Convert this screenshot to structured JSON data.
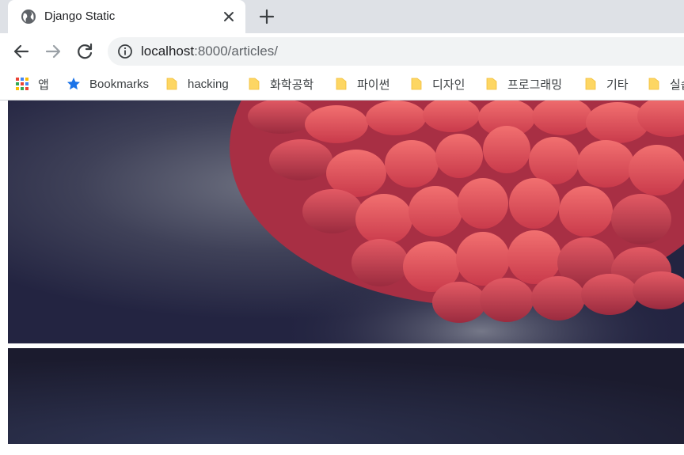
{
  "tab": {
    "title": "Django Static",
    "favicon": "globe-icon",
    "close": "close-icon"
  },
  "new_tab": "plus-icon",
  "toolbar": {
    "back": "arrow-left-icon",
    "forward": "arrow-right-icon",
    "reload": "reload-icon",
    "site_info": "info-icon",
    "url_host": "localhost",
    "url_rest": ":8000/articles/"
  },
  "bookmarks": [
    {
      "label": "앱",
      "icon": "apps-grid-icon"
    },
    {
      "label": "Bookmarks",
      "icon": "star-icon"
    },
    {
      "label": "hacking",
      "icon": "folder-icon"
    },
    {
      "label": "화학공학",
      "icon": "folder-icon"
    },
    {
      "label": "파이썬",
      "icon": "folder-icon"
    },
    {
      "label": "디자인",
      "icon": "folder-icon"
    },
    {
      "label": "프로그래밍",
      "icon": "folder-icon"
    },
    {
      "label": "기타",
      "icon": "folder-icon"
    },
    {
      "label": "실습",
      "icon": "folder-icon"
    }
  ],
  "content": {
    "images": [
      {
        "subject": "red dahlia flower on dark navy background"
      },
      {
        "subject": "dark navy textured background"
      }
    ]
  },
  "colors": {
    "tabstrip": "#dee1e6",
    "omnibox": "#f1f3f4",
    "star": "#1a73e8",
    "folder": "#fdd663",
    "photo_bg": "#262845",
    "petal": "#e8525f"
  }
}
